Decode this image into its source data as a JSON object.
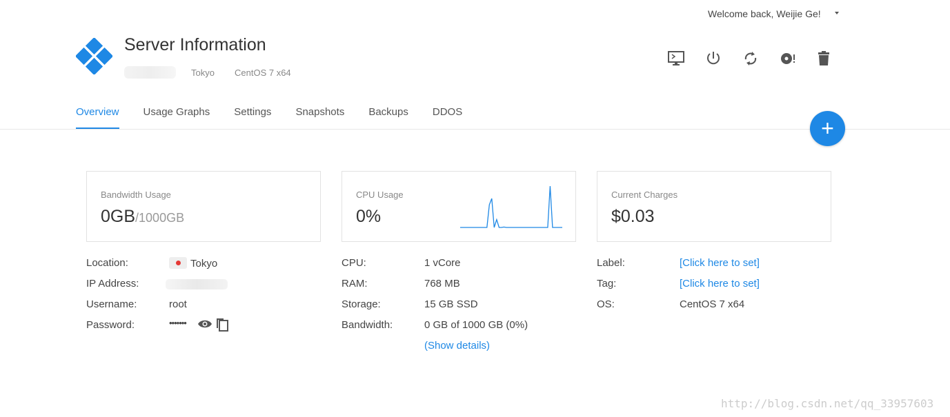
{
  "header": {
    "welcome": "Welcome back, Weijie Ge!",
    "title": "Server Information",
    "location": "Tokyo",
    "os": "CentOS 7 x64"
  },
  "actions": [
    "console-icon",
    "power-icon",
    "restart-icon",
    "reinstall-icon",
    "delete-icon"
  ],
  "tabs": [
    {
      "label": "Overview",
      "active": true
    },
    {
      "label": "Usage Graphs"
    },
    {
      "label": "Settings"
    },
    {
      "label": "Snapshots"
    },
    {
      "label": "Backups"
    },
    {
      "label": "DDOS"
    }
  ],
  "fab": "+",
  "cards": {
    "bandwidth": {
      "label": "Bandwidth Usage",
      "value": "0GB",
      "total": "/1000GB"
    },
    "cpu": {
      "label": "CPU Usage",
      "value": "0%"
    },
    "charges": {
      "label": "Current Charges",
      "value": "$0.03"
    }
  },
  "chart_data": {
    "type": "line",
    "values": [
      0,
      0,
      0,
      0,
      0,
      0,
      0,
      0,
      0,
      0,
      0,
      0,
      55,
      70,
      0,
      19,
      0,
      0,
      1,
      0,
      0,
      0,
      0,
      0,
      0,
      0,
      0,
      0,
      0,
      0,
      0,
      0,
      0,
      0,
      0,
      0,
      0,
      100,
      0,
      0,
      0,
      0,
      0
    ],
    "color": "#1e88e5"
  },
  "col1": {
    "location_label": "Location:",
    "location": "Tokyo",
    "ip_label": "IP Address:",
    "username_label": "Username:",
    "username": "root",
    "password_label": "Password:",
    "password": "•••••••"
  },
  "col2": {
    "cpu_label": "CPU:",
    "cpu": "1 vCore",
    "ram_label": "RAM:",
    "ram": "768 MB",
    "storage_label": "Storage:",
    "storage": "15 GB SSD",
    "bw_label": "Bandwidth:",
    "bw": "0 GB of 1000 GB (0%)",
    "details": "(Show details)"
  },
  "col3": {
    "label_label": "Label:",
    "label": "[Click here to set]",
    "tag_label": "Tag:",
    "tag": "[Click here to set]",
    "os_label": "OS:",
    "os": "CentOS 7 x64"
  },
  "watermark": "http://blog.csdn.net/qq_33957603",
  "colors": {
    "accent": "#1e88e5",
    "icon": "#555"
  }
}
